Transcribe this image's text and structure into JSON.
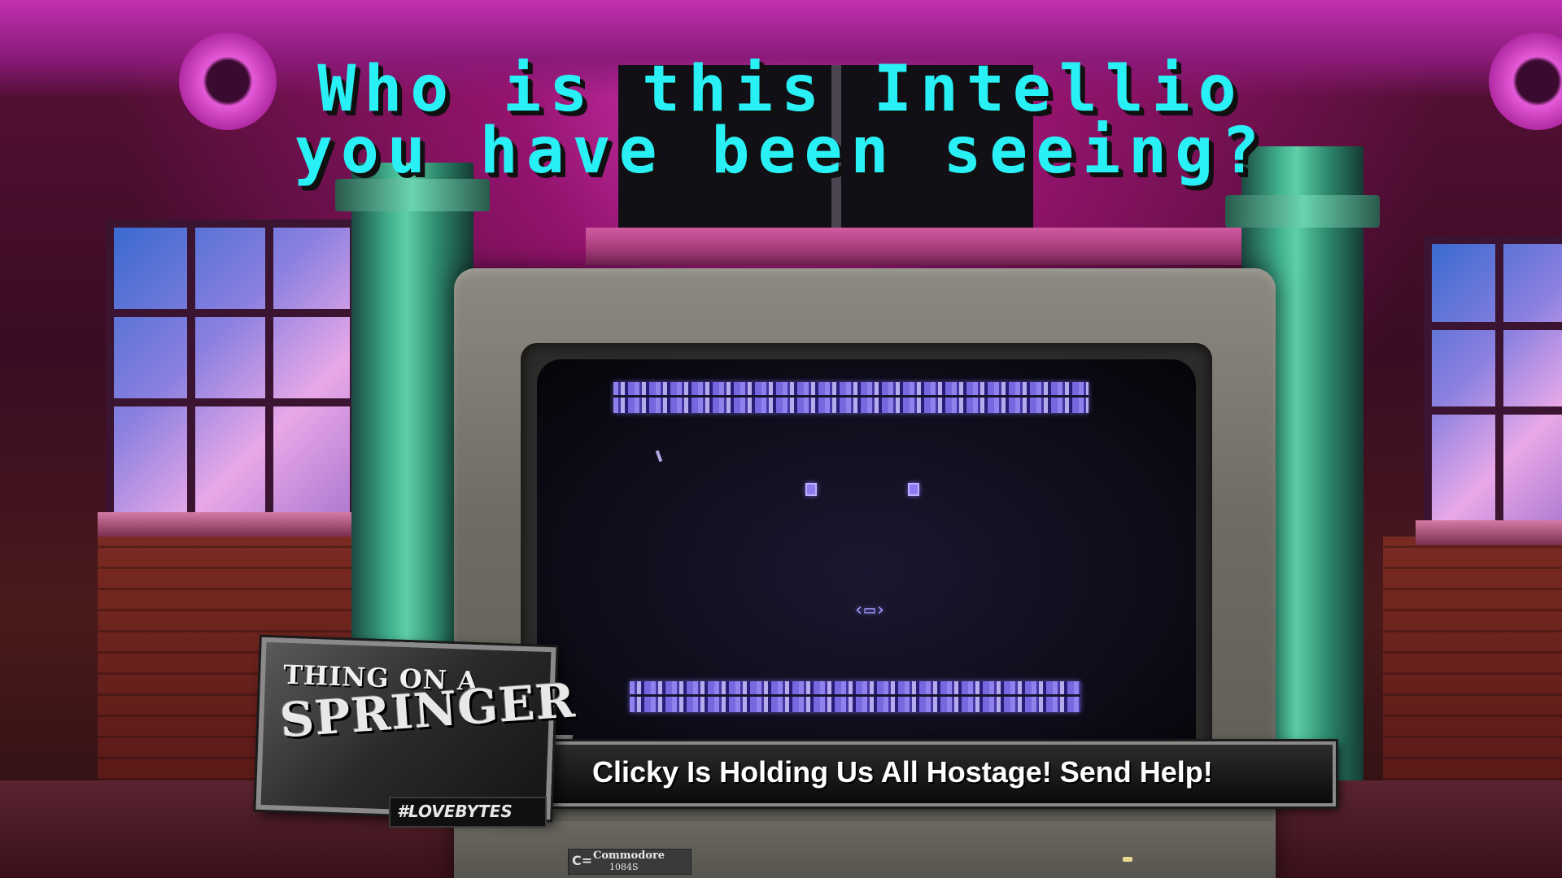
{
  "caption": {
    "line1": "Who is this Intellio",
    "line2": "you have been seeing?"
  },
  "show_logo": {
    "line1": "THING ON A",
    "line2": "SPRINGER",
    "hashtag": "#LOVEBYTES"
  },
  "ticker": {
    "text": "Clicky Is Holding Us All Hostage! Send Help!"
  },
  "monitor": {
    "brand": "Commodore",
    "model": "1084S"
  },
  "colors": {
    "caption_text": "#29f0f5",
    "crt_glow": "#8c7cf0",
    "stage_magenta": "#e040c8",
    "column_teal": "#3fae8c"
  }
}
